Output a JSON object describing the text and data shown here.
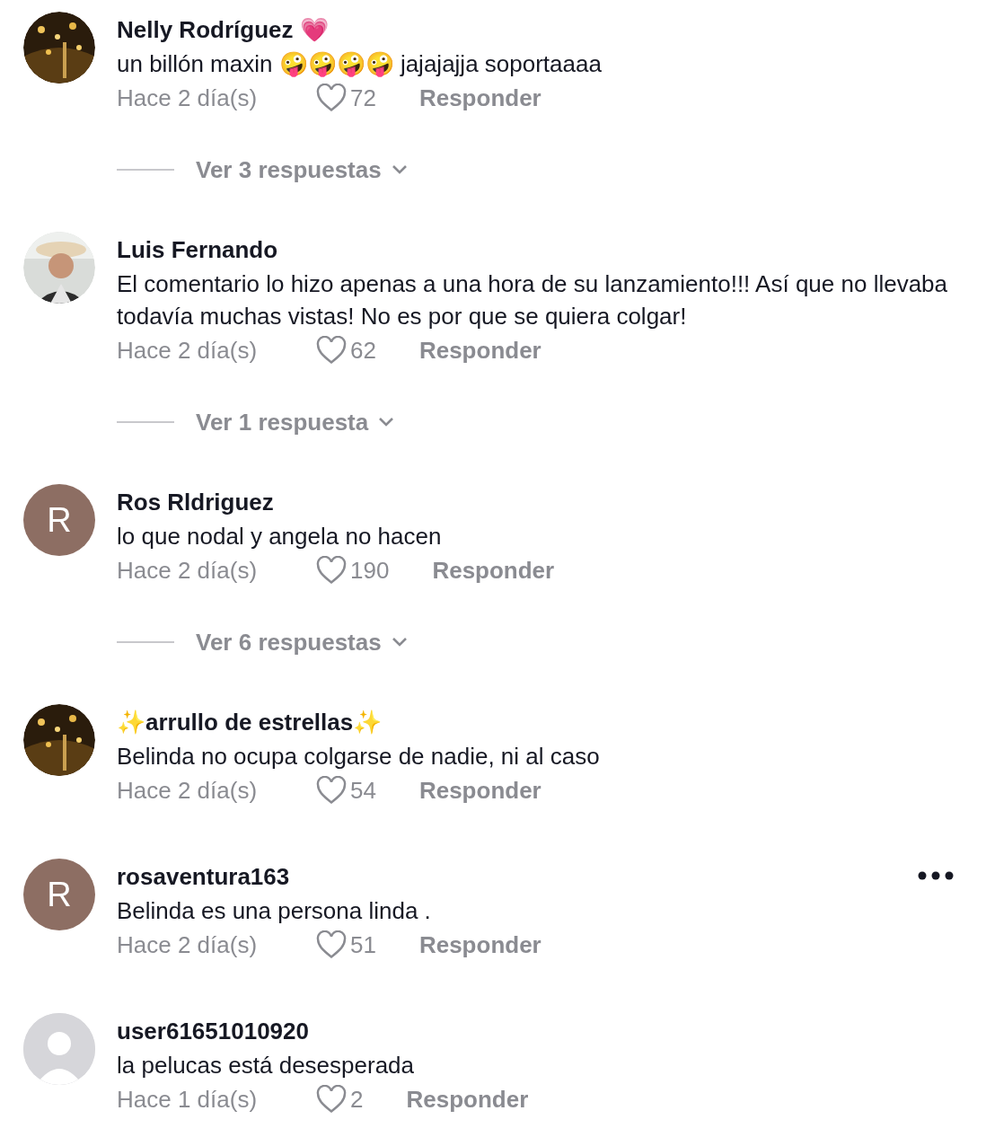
{
  "comments": [
    {
      "username": "Nelly Rodríguez 💗",
      "text": "un billón maxin 🤪🤪🤪🤪 jajajajja soportaaaa",
      "time": "Hace 2 día(s)",
      "likes": "72",
      "reply": "Responder",
      "replies": "Ver 3 respuestas",
      "menu": false
    },
    {
      "username": "Luis Fernando",
      "text": "El comentario lo hizo apenas a una hora de su lanzamiento!!! Así que no llevaba todavía muchas vistas! No es por que se quiera colgar!",
      "time": "Hace 2 día(s)",
      "likes": "62",
      "reply": "Responder",
      "replies": "Ver 1 respuesta",
      "menu": false
    },
    {
      "avatar": {
        "kind": "letter",
        "letter": "R"
      },
      "username": "Ros Rldriguez",
      "text": "lo que nodal y angela no hacen",
      "time": "Hace 2 día(s)",
      "likes": "190",
      "reply": "Responder",
      "replies": "Ver 6 respuestas",
      "menu": false
    },
    {
      "username": "✨arrullo de estrellas✨",
      "text": "Belinda no ocupa colgarse de nadie, ni al caso",
      "time": "Hace 2 día(s)",
      "likes": "54",
      "reply": "Responder",
      "menu": false
    },
    {
      "avatar": {
        "kind": "letter",
        "letter": "R"
      },
      "username": "rosaventura163",
      "text": "Belinda es una persona linda .",
      "time": "Hace 2 día(s)",
      "likes": "51",
      "reply": "Responder",
      "menu": true
    },
    {
      "avatar": {
        "kind": "default"
      },
      "username": "user61651010920",
      "text": "la pelucas está desesperada",
      "time": "Hace 1 día(s)",
      "likes": "2",
      "reply": "Responder",
      "menu": false
    }
  ]
}
